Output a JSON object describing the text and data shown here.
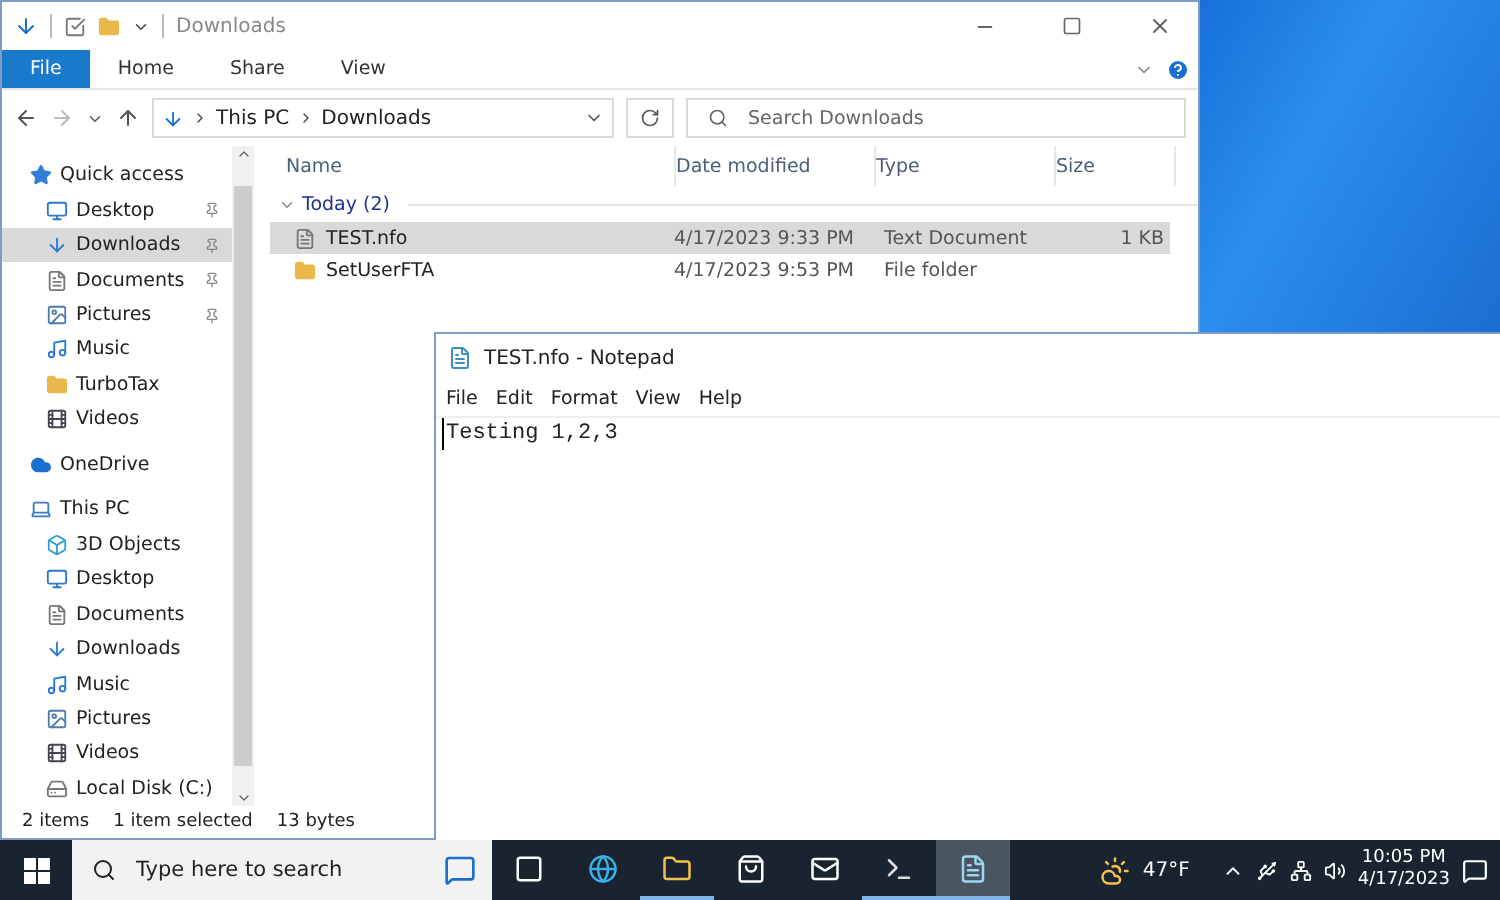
{
  "explorer": {
    "title": "Downloads",
    "ribbon_tabs": [
      {
        "label": "File",
        "selected": true
      },
      {
        "label": "Home",
        "selected": false
      },
      {
        "label": "Share",
        "selected": false
      },
      {
        "label": "View",
        "selected": false
      }
    ],
    "address": {
      "path": [
        "This PC",
        "Downloads"
      ]
    },
    "search": {
      "placeholder": "Search Downloads"
    },
    "nav": [
      {
        "label": "Quick access",
        "kind": "star",
        "children": [
          {
            "label": "Desktop",
            "kind": "desktop",
            "pinned": true,
            "selected": false
          },
          {
            "label": "Downloads",
            "kind": "download",
            "pinned": true,
            "selected": true
          },
          {
            "label": "Documents",
            "kind": "document",
            "pinned": true,
            "selected": false
          },
          {
            "label": "Pictures",
            "kind": "picture",
            "pinned": true,
            "selected": false
          },
          {
            "label": "Music",
            "kind": "music",
            "pinned": false,
            "selected": false
          },
          {
            "label": "TurboTax",
            "kind": "folder",
            "pinned": false,
            "selected": false
          },
          {
            "label": "Videos",
            "kind": "video",
            "pinned": false,
            "selected": false
          }
        ]
      },
      {
        "label": "OneDrive",
        "kind": "cloud"
      },
      {
        "label": "This PC",
        "kind": "pc",
        "children": [
          {
            "label": "3D Objects",
            "kind": "cube",
            "pinned": false,
            "selected": false
          },
          {
            "label": "Desktop",
            "kind": "desktop",
            "pinned": false,
            "selected": false
          },
          {
            "label": "Documents",
            "kind": "document",
            "pinned": false,
            "selected": false
          },
          {
            "label": "Downloads",
            "kind": "download",
            "pinned": false,
            "selected": false
          },
          {
            "label": "Music",
            "kind": "music",
            "pinned": false,
            "selected": false
          },
          {
            "label": "Pictures",
            "kind": "picture",
            "pinned": false,
            "selected": false
          },
          {
            "label": "Videos",
            "kind": "video",
            "pinned": false,
            "selected": false
          },
          {
            "label": "Local Disk (C:)",
            "kind": "disk",
            "pinned": false,
            "selected": false
          }
        ]
      }
    ],
    "columns": [
      "Name",
      "Date modified",
      "Type",
      "Size"
    ],
    "group": {
      "label": "Today (2)",
      "expanded": true
    },
    "files": [
      {
        "name": "TEST.nfo",
        "kind": "document",
        "date": "4/17/2023 9:33 PM",
        "type": "Text Document",
        "size": "1 KB",
        "selected": true
      },
      {
        "name": "SetUserFTA",
        "kind": "folder",
        "date": "4/17/2023 9:53 PM",
        "type": "File folder",
        "selected": false
      }
    ],
    "status": [
      "2 items",
      "1 item selected",
      "13 bytes"
    ]
  },
  "notepad": {
    "title": "TEST.nfo - Notepad",
    "menu": [
      "File",
      "Edit",
      "Format",
      "View",
      "Help"
    ],
    "text": "Testing 1,2,3"
  },
  "taskbar": {
    "search": {
      "placeholder": "Type here to search"
    },
    "apps": [
      {
        "kind": "taskview",
        "running": false,
        "active": false
      },
      {
        "kind": "browser",
        "running": false,
        "active": false
      },
      {
        "kind": "folder",
        "running": true,
        "active": false
      },
      {
        "kind": "store",
        "running": false,
        "active": false
      },
      {
        "kind": "mail",
        "running": false,
        "active": false
      },
      {
        "kind": "terminal",
        "running": true,
        "active": false
      },
      {
        "kind": "notepad",
        "running": true,
        "active": true
      }
    ],
    "weather": "47°F",
    "time": "10:05 PM",
    "date": "4/17/2023"
  }
}
